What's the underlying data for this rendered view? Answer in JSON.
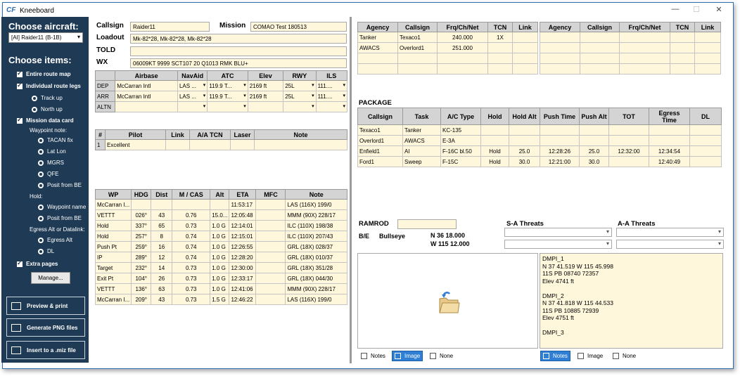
{
  "window": {
    "title": "Kneeboard",
    "icon": "CF",
    "minimize": "—",
    "maximize": "☐",
    "close": "✕"
  },
  "sidebar": {
    "choose_aircraft": "Choose aircraft:",
    "aircraft_value": "[AI] Raider11 (B-1B)",
    "choose_items": "Choose items:",
    "items": {
      "route_map": "Entire route map",
      "route_legs": "Individual route legs",
      "track_up": "Track up",
      "north_up": "North up",
      "mission_card": "Mission data card",
      "waypoint_note": "Waypoint note:",
      "tacan_fix": "TACAN fix",
      "lat_lon": "Lat Lon",
      "mgrs": "MGRS",
      "qfe": "QFE",
      "posit_be": "Posit from BE",
      "hold": "Hold:",
      "waypoint_name": "Waypoint name",
      "posit_be2": "Posit from BE",
      "egress_label": "Egress Alt or Datalink:",
      "egress_alt": "Egress Alt",
      "dl": "DL",
      "extra_pages": "Extra pages"
    },
    "manage": "Manage...",
    "preview": "Preview & print",
    "png": "Generate PNG files",
    "insert": "Insert to a .miz file"
  },
  "mission": {
    "callsign_label": "Callsign",
    "callsign": "Raider11",
    "mission_label": "Mission",
    "mission": "COMAO Test 180513",
    "loadout_label": "Loadout",
    "loadout": "Mk-82*28, Mk-82*28, Mk-82*28",
    "told_label": "TOLD",
    "told": "",
    "wx_label": "WX",
    "wx": "06009KT 9999 SCT107 20 Q1013 RMK BLU+"
  },
  "airfields": {
    "headers": [
      "",
      "Airbase",
      "NavAid",
      "ATC",
      "Elev",
      "RWY",
      "ILS"
    ],
    "rows": [
      [
        "DEP",
        "McCarran Intl",
        "LAS ...",
        "119.9 T...",
        "2169 ft",
        "25L",
        "111...."
      ],
      [
        "ARR",
        "McCarran Intl",
        "LAS ...",
        "119.9 T...",
        "2169 ft",
        "25L",
        "111...."
      ],
      [
        "ALTN",
        "",
        "",
        "",
        "",
        "",
        ""
      ]
    ]
  },
  "flight": {
    "headers": [
      "#",
      "Pilot",
      "Link",
      "A/A TCN",
      "Laser",
      "Note"
    ],
    "rows": [
      [
        "1",
        "Excellent",
        "",
        "",
        "",
        ""
      ]
    ]
  },
  "waypoints": {
    "headers": [
      "WP",
      "HDG",
      "Dist",
      "M / CAS",
      "Alt",
      "ETA",
      "MFC",
      "Note"
    ],
    "rows": [
      [
        "McCarran I...",
        "",
        "",
        "",
        "",
        "11:53:17",
        "",
        "LAS (116X) 199/0"
      ],
      [
        "VETTT",
        "026°",
        "43",
        "0.76",
        "15.0...",
        "12:05:48",
        "",
        "MMM (90X) 228/17"
      ],
      [
        "Hold",
        "337°",
        "65",
        "0.73",
        "1.0 G",
        "12:14:01",
        "",
        "ILC (110X) 198/38"
      ],
      [
        "Hold",
        "257°",
        "8",
        "0.74",
        "1.0 G",
        "12:15:01",
        "",
        "ILC (110X) 207/43"
      ],
      [
        "Push Pt",
        "259°",
        "16",
        "0.74",
        "1.0 G",
        "12:26:55",
        "",
        "GRL (18X) 028/37"
      ],
      [
        "IP",
        "289°",
        "12",
        "0.74",
        "1.0 G",
        "12:28:20",
        "",
        "GRL (18X) 010/37"
      ],
      [
        "Target",
        "232°",
        "14",
        "0.73",
        "1.0 G",
        "12:30:00",
        "",
        "GRL (18X) 351/28"
      ],
      [
        "Exit Pt",
        "104°",
        "26",
        "0.73",
        "1.0 G",
        "12:33:17",
        "",
        "GRL (18X) 044/30"
      ],
      [
        "VETTT",
        "136°",
        "63",
        "0.73",
        "1.0 G",
        "12:41:06",
        "",
        "MMM (90X) 228/17"
      ],
      [
        "McCarran I...",
        "209°",
        "43",
        "0.73",
        "1.5 G",
        "12:46:22",
        "",
        "LAS (116X) 199/0"
      ]
    ]
  },
  "comms_left": {
    "headers": [
      "Agency",
      "Callsign",
      "Frq/Ch/Net",
      "TCN",
      "Link"
    ],
    "rows": [
      [
        "Tanker",
        "Texaco1",
        "240.000",
        "1X",
        ""
      ],
      [
        "AWACS",
        "Overlord1",
        "251.000",
        "",
        ""
      ],
      [
        "",
        "",
        "",
        "",
        ""
      ],
      [
        "",
        "",
        "",
        "",
        ""
      ]
    ]
  },
  "comms_right": {
    "headers": [
      "Agency",
      "Callsign",
      "Frq/Ch/Net",
      "TCN",
      "Link"
    ],
    "rows": [
      [
        "",
        "",
        "",
        "",
        ""
      ],
      [
        "",
        "",
        "",
        "",
        ""
      ],
      [
        "",
        "",
        "",
        "",
        ""
      ],
      [
        "",
        "",
        "",
        "",
        ""
      ]
    ]
  },
  "package": {
    "title": "PACKAGE",
    "headers": [
      "Callsign",
      "Task",
      "A/C Type",
      "Hold",
      "Hold Alt",
      "Push Time",
      "Push Alt",
      "TOT",
      "Egress Time",
      "DL"
    ],
    "rows": [
      [
        "Texaco1",
        "Tanker",
        "KC-135",
        "",
        "",
        "",
        "",
        "",
        "",
        ""
      ],
      [
        "Overlord1",
        "AWACS",
        "E-3A",
        "",
        "",
        "",
        "",
        "",
        "",
        ""
      ],
      [
        "Enfield1",
        "AI",
        "F-16C bl.50",
        "Hold",
        "25.0",
        "12:28:26",
        "25.0",
        "12:32:00",
        "12:34:54",
        ""
      ],
      [
        "Ford1",
        "Sweep",
        "F-15C",
        "Hold",
        "30.0",
        "12:21:00",
        "30.0",
        "",
        "12:40:49",
        ""
      ]
    ]
  },
  "ramrod": {
    "label": "RAMROD",
    "value": ""
  },
  "bullseye": {
    "be_label": "B/E",
    "name": "Bullseye",
    "lat": "N 36 18.000",
    "lon": "W 115 12.000"
  },
  "threats": {
    "sa_label": "S-A Threats",
    "aa_label": "A-A Threats"
  },
  "notes_text": [
    "DMPI_1",
    "N 37 41.519 W 115 45.998",
    "11S PB 08740 72357",
    "Elev 4741 ft",
    "",
    "DMPI_2",
    "N 37 41.818 W 115 44.533",
    "11S PB 10885 72939",
    "Elev 4751 ft",
    "",
    "DMPI_3"
  ],
  "tabs": {
    "notes": "Notes",
    "image": "Image",
    "none": "None"
  },
  "colors": {
    "sidebar": "#1f3a54",
    "input": "#fff7dc",
    "header": "#d4d4d4",
    "accent": "#2f7fd4"
  }
}
